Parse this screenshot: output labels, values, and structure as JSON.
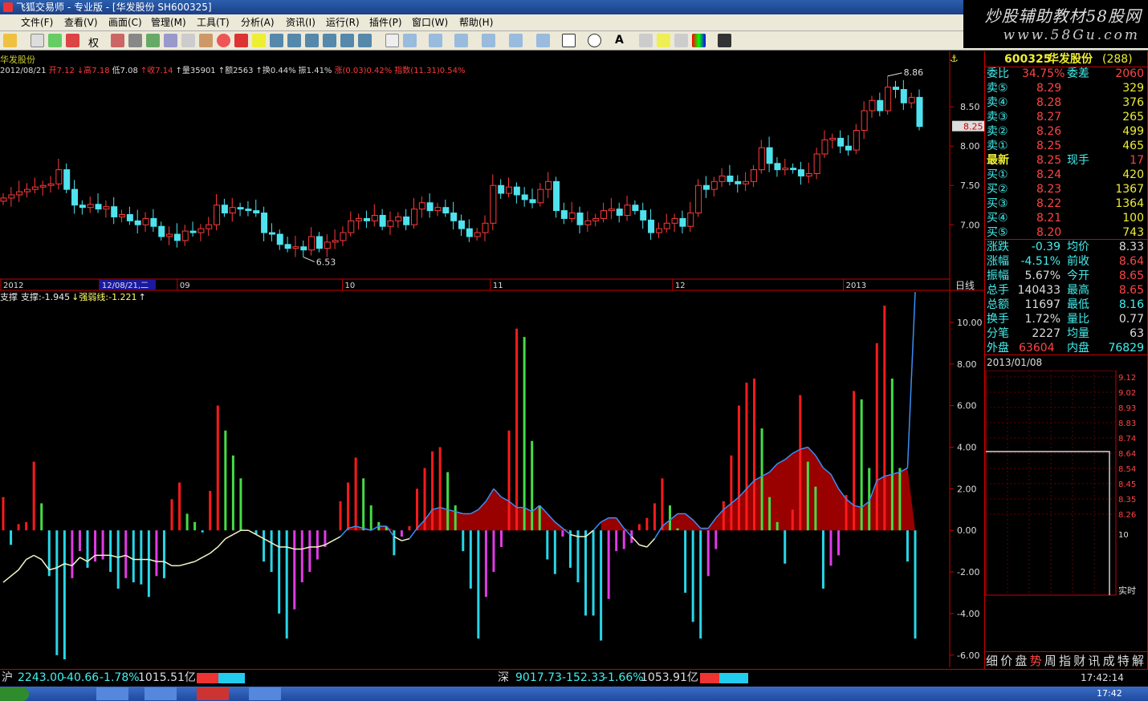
{
  "window": {
    "title": "飞狐交易师 - 专业版 - [华发股份 SH600325]"
  },
  "watermark": {
    "line1": "炒股辅助教材58股网",
    "line2": "www.58Gu.com"
  },
  "menu": [
    "文件(F)",
    "查看(V)",
    "画面(C)",
    "管理(M)",
    "工具(T)",
    "分析(A)",
    "资讯(I)",
    "运行(R)",
    "插件(P)",
    "窗口(W)",
    "帮助(H)"
  ],
  "toolbar": {
    "rights_label": "权"
  },
  "kline": {
    "stock_name": "华发股份",
    "info": [
      {
        "label": "2012/08/21",
        "color": "#dddddd"
      },
      {
        "label": "开7.12",
        "color": "#ff3a3a"
      },
      {
        "label": "↓高7.18",
        "color": "#ff3a3a"
      },
      {
        "label": "低7.08",
        "color": "#dddddd"
      },
      {
        "label": "↑收7.14",
        "color": "#ff3a3a"
      },
      {
        "label": "↑量35901",
        "color": "#dddddd"
      },
      {
        "label": "↑额2563",
        "color": "#dddddd"
      },
      {
        "label": "↑换0.44%",
        "color": "#dddddd"
      },
      {
        "label": "振1.41%",
        "color": "#dddddd"
      },
      {
        "label": "涨(0.03)0.42%",
        "color": "#ff3a3a"
      },
      {
        "label": "指数(11.31)0.54%",
        "color": "#ff3a3a"
      }
    ],
    "price_ticks": [
      "8.50",
      "8.00",
      "7.50",
      "7.00"
    ],
    "price_range": [
      6.35,
      8.95
    ],
    "high_label": "8.86",
    "low_label": "6.53",
    "last_price": "8.25",
    "x_labels": [
      {
        "text": "2012",
        "pos": 0.0
      },
      {
        "text": "12/08/21,二",
        "pos": 0.104
      },
      {
        "text": "09",
        "pos": 0.186
      },
      {
        "text": "10",
        "pos": 0.36
      },
      {
        "text": "11",
        "pos": 0.516
      },
      {
        "text": "12",
        "pos": 0.708
      },
      {
        "text": "2013",
        "pos": 0.888
      }
    ],
    "period_label": "日线",
    "closes": [
      7.34,
      7.38,
      7.42,
      7.45,
      7.48,
      7.5,
      7.52,
      7.7,
      7.45,
      7.25,
      7.22,
      7.26,
      7.2,
      7.23,
      7.1,
      7.13,
      7.05,
      7.0,
      7.08,
      6.98,
      6.85,
      6.88,
      6.8,
      6.92,
      6.9,
      6.95,
      7.0,
      7.25,
      7.15,
      7.22,
      7.2,
      7.18,
      7.15,
      6.9,
      6.88,
      6.75,
      6.7,
      6.72,
      6.68,
      6.85,
      6.7,
      6.78,
      6.8,
      6.9,
      7.05,
      7.08,
      7.05,
      7.12,
      6.98,
      7.05,
      7.1,
      7.0,
      7.2,
      7.28,
      7.18,
      7.22,
      7.15,
      7.05,
      6.95,
      6.85,
      6.9,
      7.02,
      7.5,
      7.4,
      7.48,
      7.38,
      7.32,
      7.28,
      7.45,
      7.55,
      7.18,
      7.08,
      7.15,
      7.0,
      7.05,
      7.08,
      7.18,
      7.2,
      7.12,
      7.25,
      7.18,
      7.06,
      6.9,
      6.95,
      7.02,
      7.08,
      6.98,
      7.15,
      7.5,
      7.45,
      7.55,
      7.62,
      7.55,
      7.52,
      7.55,
      7.7,
      7.98,
      7.78,
      7.7,
      7.72,
      7.7,
      7.62,
      7.65,
      7.9,
      8.08,
      8.1,
      8.0,
      7.95,
      8.2,
      8.45,
      8.58,
      8.45,
      8.75,
      8.72,
      8.55,
      8.62,
      8.25
    ]
  },
  "indicator": {
    "title": "支撑",
    "values": [
      {
        "label": "支撑:-1.945",
        "color": "#eeeeee"
      },
      {
        "label": "↓强弱线:-1.221",
        "color": "#ffff66"
      },
      {
        "label": "↑",
        "color": "#eeeeee"
      }
    ],
    "y_ticks": [
      "10.00",
      "8.00",
      "6.00",
      "4.00",
      "2.00",
      "0.00",
      "-2.00",
      "-4.00",
      "-6.00"
    ],
    "y_range": [
      -6.2,
      11.0
    ],
    "bars": [
      1.6,
      -0.7,
      0.3,
      0.4,
      3.3,
      1.3,
      -2.2,
      -6.0,
      -6.2,
      -2.3,
      -1.0,
      -1.8,
      -1.5,
      -1.4,
      -2.0,
      -2.8,
      -2.3,
      -2.5,
      -2.6,
      -3.2,
      -2.2,
      -2.3,
      1.5,
      2.3,
      0.8,
      0.4,
      -0.1,
      1.9,
      6.0,
      4.8,
      3.6,
      2.5,
      0.0,
      -0.2,
      -1.5,
      -2.0,
      -4.0,
      -5.2,
      -3.8,
      -2.5,
      -2.0,
      -1.4,
      -0.8,
      0.0,
      1.4,
      2.3,
      3.5,
      2.5,
      1.2,
      0.4,
      0.2,
      -1.2,
      -0.3,
      0.2,
      2.0,
      3.0,
      3.8,
      4.0,
      2.8,
      1.2,
      -1.0,
      -2.8,
      -5.2,
      -3.2,
      -2.0,
      -0.8,
      4.8,
      9.7,
      9.3,
      4.3,
      1.2,
      -1.4,
      -2.1,
      -0.3,
      -1.8,
      -2.5,
      -4.1,
      -4.1,
      -5.3,
      -3.3,
      -1.0,
      -0.9,
      -0.6,
      0.3,
      0.6,
      1.3,
      2.5,
      1.2,
      0.1,
      -3.0,
      -4.4,
      -5.2,
      -2.2,
      -0.9,
      1.4,
      3.6,
      6.0,
      7.1,
      7.3,
      4.9,
      1.6,
      0.4,
      -1.6,
      1.0,
      6.5,
      3.3,
      2.1,
      -2.8,
      -1.7,
      -1.2,
      1.7,
      6.7,
      6.3,
      3.0,
      9.0,
      10.8,
      7.3,
      3.0,
      -1.5,
      -5.2
    ],
    "line": [
      -2.5,
      -2.2,
      -1.9,
      -1.4,
      -1.2,
      -1.4,
      -1.9,
      -1.8,
      -1.6,
      -1.7,
      -1.3,
      -1.5,
      -1.2,
      -1.2,
      -1.2,
      -1.3,
      -1.2,
      -1.4,
      -1.4,
      -1.4,
      -1.5,
      -1.5,
      -1.7,
      -1.7,
      -1.6,
      -1.5,
      -1.3,
      -1.1,
      -0.8,
      -0.4,
      -0.2,
      0.0,
      0.0,
      -0.2,
      -0.4,
      -0.6,
      -0.8,
      -0.8,
      -0.9,
      -0.9,
      -0.8,
      -0.8,
      -0.7,
      -0.5,
      -0.3,
      0.1,
      0.2,
      0.1,
      0.0,
      0.2,
      0.2,
      -0.3,
      -0.5,
      -0.4,
      0.1,
      0.5,
      1.0,
      1.1,
      1.0,
      0.9,
      0.8,
      0.8,
      1.0,
      1.4,
      2.0,
      1.6,
      1.4,
      1.1,
      1.1,
      0.9,
      1.2,
      0.8,
      0.4,
      0.1,
      -0.2,
      -0.3,
      -0.3,
      0.0,
      0.4,
      0.6,
      0.6,
      0.1,
      -0.3,
      -0.7,
      -0.8,
      -0.4,
      0.2,
      0.5,
      0.8,
      0.8,
      0.5,
      0.1,
      0.1,
      0.6,
      1.0,
      1.3,
      1.6,
      2.0,
      2.4,
      2.6,
      2.8,
      3.2,
      3.4,
      3.7,
      3.9,
      4.0,
      3.6,
      3.0,
      2.7,
      2.0,
      1.5,
      1.2,
      1.1,
      1.4,
      2.4,
      2.6,
      2.7,
      2.8,
      3.0
    ],
    "colors": {
      "up": "#ff1a1a",
      "dn_bar": "#27d6e8",
      "magenta": "#e23ae6",
      "green": "#44dd44",
      "fill": "#990000",
      "line_pos": "#3a8ef6",
      "line_neg": "#f4f4c8"
    }
  },
  "quote": {
    "header": {
      "code": "600325",
      "name": "华发股份",
      "rank": "(288)"
    },
    "weibi": {
      "label": "委比",
      "value": "34.75%",
      "label2": "委差",
      "value2": "2060"
    },
    "sells": [
      {
        "label": "卖⑤",
        "price": "8.29",
        "vol": "329"
      },
      {
        "label": "卖④",
        "price": "8.28",
        "vol": "376"
      },
      {
        "label": "卖③",
        "price": "8.27",
        "vol": "265"
      },
      {
        "label": "卖②",
        "price": "8.26",
        "vol": "499"
      },
      {
        "label": "卖①",
        "price": "8.25",
        "vol": "465"
      }
    ],
    "latest": {
      "label": "最新",
      "price": "8.25",
      "label2": "现手",
      "vol": "17"
    },
    "buys": [
      {
        "label": "买①",
        "price": "8.24",
        "vol": "420"
      },
      {
        "label": "买②",
        "price": "8.23",
        "vol": "1367"
      },
      {
        "label": "买③",
        "price": "8.22",
        "vol": "1364"
      },
      {
        "label": "买④",
        "price": "8.21",
        "vol": "100"
      },
      {
        "label": "买⑤",
        "price": "8.20",
        "vol": "743"
      }
    ],
    "stats": [
      {
        "l1": "涨跌",
        "v1": "-0.39",
        "l2": "均价",
        "v2": "8.33"
      },
      {
        "l1": "涨幅",
        "v1": "-4.51%",
        "l2": "前收",
        "v2": "8.64"
      },
      {
        "l1": "振幅",
        "v1": "5.67%",
        "l2": "今开",
        "v2": "8.65"
      },
      {
        "l1": "总手",
        "v1": "140433",
        "l2": "最高",
        "v2": "8.65"
      },
      {
        "l1": "总额",
        "v1": "11697",
        "l2": "最低",
        "v2": "8.16"
      },
      {
        "l1": "换手",
        "v1": "1.72%",
        "l2": "量比",
        "v2": "0.77"
      },
      {
        "l1": "分笔",
        "v1": "2227",
        "l2": "均量",
        "v2": "63"
      }
    ],
    "outer": {
      "l1": "外盘",
      "v1": "63604",
      "l2": "内盘",
      "v2": "76829"
    },
    "mini_date": "2013/01/08",
    "mini_ticks": [
      "9.12",
      "9.02",
      "8.93",
      "8.83",
      "8.74",
      "8.64",
      "8.54",
      "8.45",
      "8.35",
      "8.26"
    ],
    "mini_vol_tick": "10",
    "mini_realtime": "实时",
    "tabs": [
      "细",
      "价",
      "盘",
      "势",
      "周",
      "指",
      "财",
      "讯",
      "成",
      "特",
      "解"
    ],
    "active_tab": 3
  },
  "bottombar": {
    "sh_label": "沪",
    "sh_value": "2243.00",
    "sh_change": "-40.66",
    "sh_pct": "-1.78%",
    "sh_amount": "1015.51亿",
    "sz_label": "深",
    "sz_value": "9017.73",
    "sz_change": "-152.33",
    "sz_pct": "-1.66%",
    "sz_amount": "1053.91亿",
    "time": "17:42:14"
  },
  "taskbar": {
    "clock": "17:42"
  }
}
